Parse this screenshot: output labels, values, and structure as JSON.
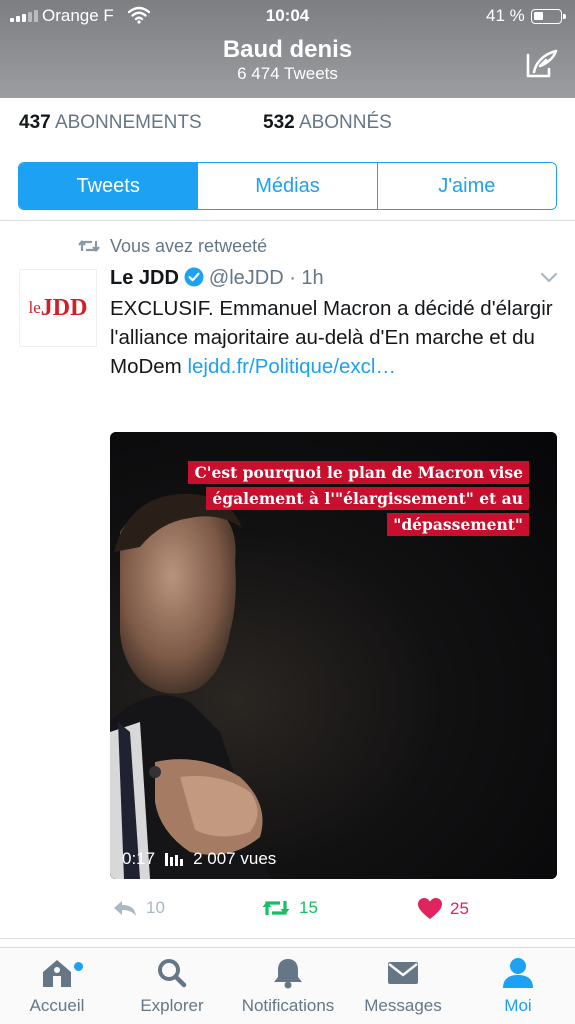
{
  "status_bar": {
    "carrier": "Orange F",
    "time": "10:04",
    "battery": "41 %"
  },
  "profile": {
    "name": "Baud denis",
    "tweet_count": "6 474 Tweets"
  },
  "stats": {
    "following_count": "437",
    "following_label": "ABONNEMENTS",
    "followers_count": "532",
    "followers_label": "ABONNÉS"
  },
  "segments": [
    {
      "label": "Tweets",
      "active": true
    },
    {
      "label": "Médias",
      "active": false
    },
    {
      "label": "J'aime",
      "active": false
    }
  ],
  "tweet": {
    "retweet_context": "Vous avez retweeté",
    "avatar_logo": {
      "le": "le",
      "brand": "JDD"
    },
    "author": "Le JDD",
    "handle_time": "@leJDD · 1h",
    "text": "EXCLUSIF. Emmanuel Macron a décidé d'élargir l'alliance majoritaire au-delà d'En marche et du MoDem ",
    "link": "lejdd.fr/Politique/excl…",
    "media": {
      "overlay_lines": [
        "C'est pourquoi le plan de Macron vise",
        "également à l'\"élargissement\" et au",
        "\"dépassement\""
      ],
      "duration": "0:17",
      "views": "2 007 vues"
    },
    "reply_count": "10",
    "retweet_count": "15",
    "like_count": "25"
  },
  "tabs": [
    {
      "label": "Accueil",
      "icon": "home-icon",
      "active": false
    },
    {
      "label": "Explorer",
      "icon": "search-icon",
      "active": false
    },
    {
      "label": "Notifications",
      "icon": "bell-icon",
      "active": false
    },
    {
      "label": "Messages",
      "icon": "envelope-icon",
      "active": false
    },
    {
      "label": "Moi",
      "icon": "person-icon",
      "active": true
    }
  ],
  "colors": {
    "accent": "#1da1f2",
    "retweet_green": "#17bf63",
    "like_red": "#e0245e",
    "overlay_red": "#c8102e",
    "brand_red": "#d21e26"
  }
}
